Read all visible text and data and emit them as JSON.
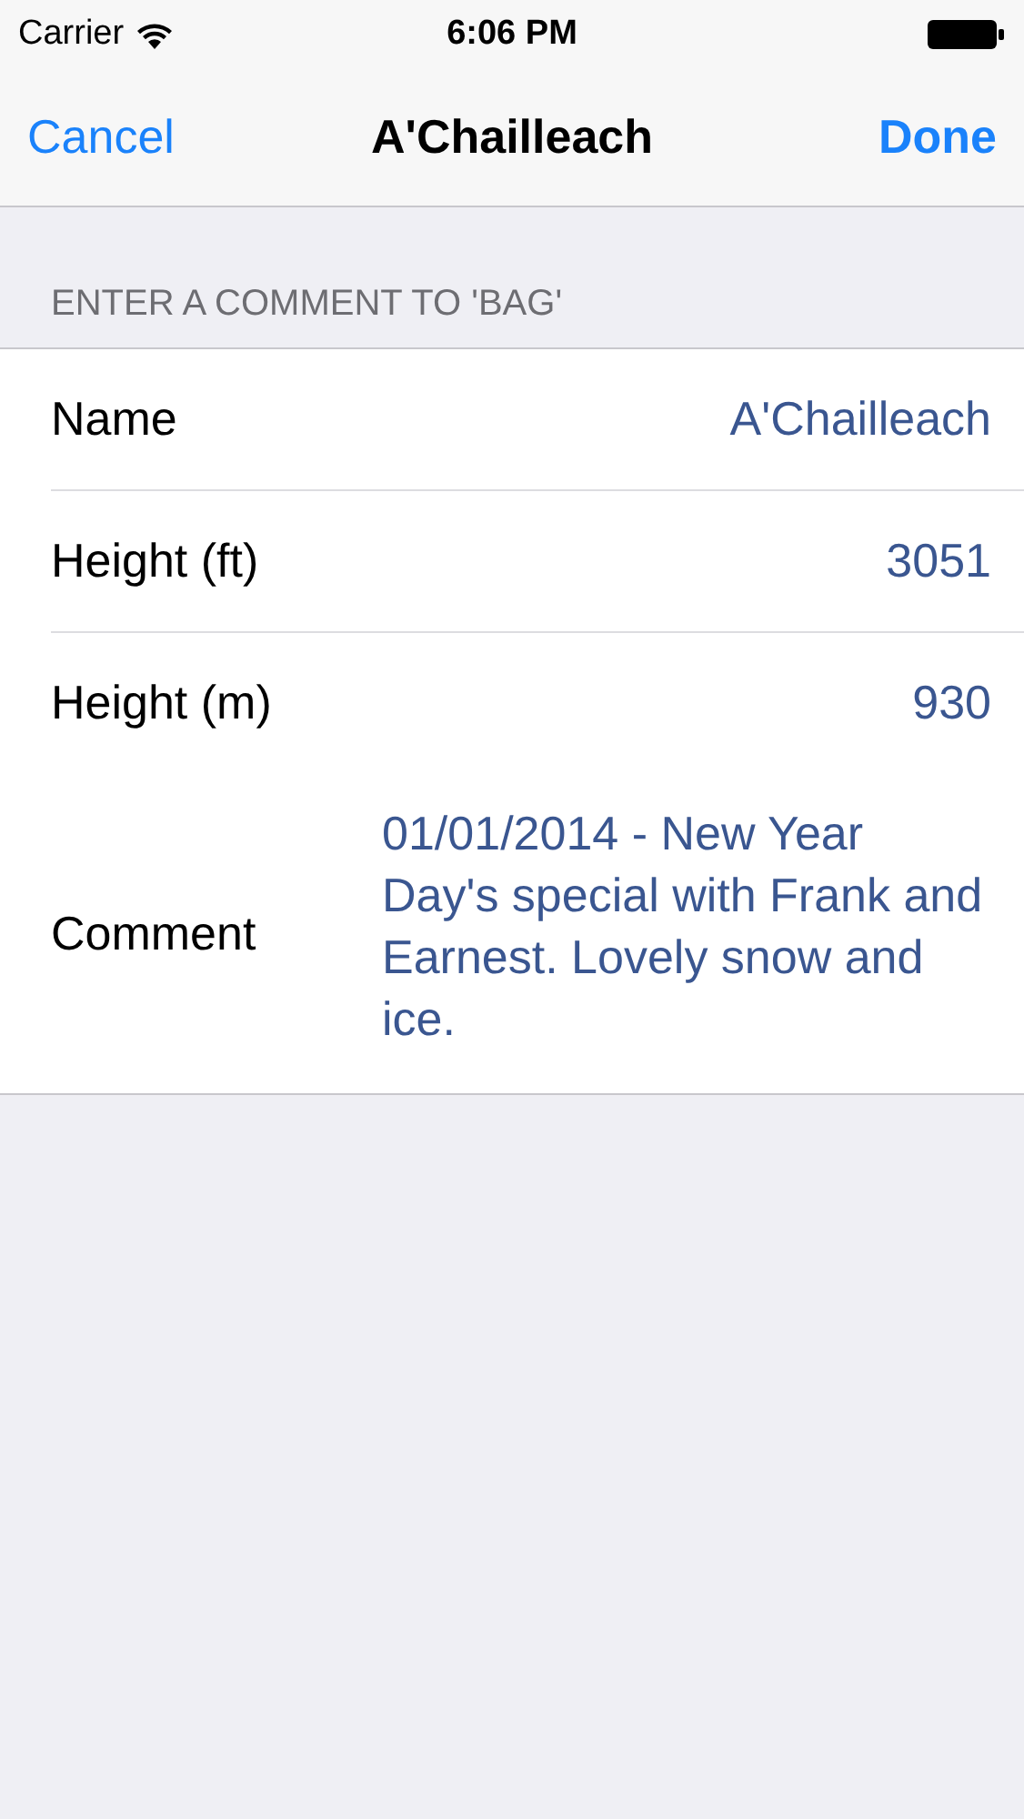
{
  "status_bar": {
    "carrier": "Carrier",
    "time": "6:06 PM"
  },
  "nav_bar": {
    "left_button": "Cancel",
    "title": "A'Chailleach",
    "right_button": "Done"
  },
  "section": {
    "header": "ENTER A COMMENT TO 'BAG'",
    "rows": [
      {
        "kind": "value",
        "label": "Name",
        "value": "A'Chailleach"
      },
      {
        "kind": "value",
        "label": "Height (ft)",
        "value": "3051"
      },
      {
        "kind": "value",
        "label": "Height (m)",
        "value": "930"
      },
      {
        "kind": "textarea",
        "label": "Comment",
        "value": "01/01/2014 - New Year Day's special with Frank and Earnest. Lovely snow and ice."
      }
    ]
  }
}
